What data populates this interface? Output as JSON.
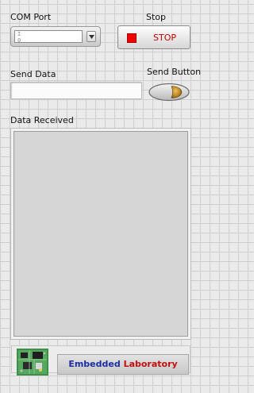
{
  "com_port": {
    "label": "COM Port",
    "value": "",
    "icon": "io-resource-icon"
  },
  "stop": {
    "label": "Stop",
    "button_text": "STOP",
    "indicator_color": "#f50000"
  },
  "send_data": {
    "label": "Send Data",
    "value": ""
  },
  "send_button": {
    "label": "Send Button",
    "icon": "send-toggle-icon"
  },
  "data_received": {
    "label": "Data Received",
    "value": ""
  },
  "footer": {
    "word1": "Embedded",
    "word2": "Laboratory",
    "word1_color": "#1c2da0",
    "word2_color": "#c01010",
    "logo_icon": "circuit-board-icon"
  }
}
